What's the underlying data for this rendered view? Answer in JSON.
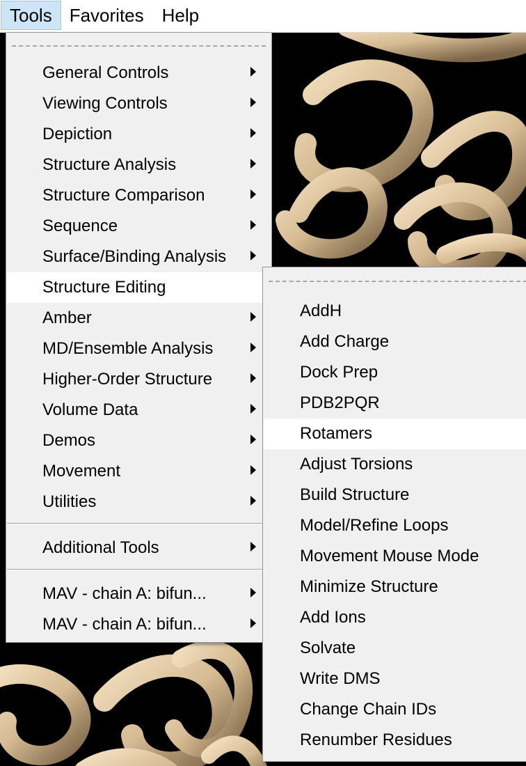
{
  "menubar": {
    "items": [
      {
        "label": "Tools",
        "active": true
      },
      {
        "label": "Favorites",
        "active": false
      },
      {
        "label": "Help",
        "active": false
      }
    ]
  },
  "tools_menu": {
    "items": [
      {
        "label": "General Controls",
        "submenu": true
      },
      {
        "label": "Viewing Controls",
        "submenu": true
      },
      {
        "label": "Depiction",
        "submenu": true
      },
      {
        "label": "Structure Analysis",
        "submenu": true
      },
      {
        "label": "Structure Comparison",
        "submenu": true
      },
      {
        "label": "Sequence",
        "submenu": true
      },
      {
        "label": "Surface/Binding Analysis",
        "submenu": true
      },
      {
        "label": "Structure Editing",
        "submenu": true,
        "highlighted": true
      },
      {
        "label": "Amber",
        "submenu": true
      },
      {
        "label": "MD/Ensemble Analysis",
        "submenu": true
      },
      {
        "label": "Higher-Order Structure",
        "submenu": true
      },
      {
        "label": "Volume Data",
        "submenu": true
      },
      {
        "label": "Demos",
        "submenu": true
      },
      {
        "label": "Movement",
        "submenu": true
      },
      {
        "label": "Utilities",
        "submenu": true
      }
    ],
    "additional": {
      "label": "Additional Tools",
      "submenu": true
    },
    "mav_items": [
      {
        "label": "MAV - chain A: bifun...",
        "submenu": true
      },
      {
        "label": "MAV - chain A: bifun...",
        "submenu": true
      }
    ]
  },
  "structure_editing_menu": {
    "items": [
      {
        "label": "AddH"
      },
      {
        "label": "Add Charge"
      },
      {
        "label": "Dock Prep"
      },
      {
        "label": "PDB2PQR"
      },
      {
        "label": "Rotamers",
        "highlighted": true
      },
      {
        "label": "Adjust Torsions"
      },
      {
        "label": "Build Structure"
      },
      {
        "label": "Model/Refine Loops"
      },
      {
        "label": "Movement Mouse Mode"
      },
      {
        "label": "Minimize Structure"
      },
      {
        "label": "Add Ions"
      },
      {
        "label": "Solvate"
      },
      {
        "label": "Write DMS"
      },
      {
        "label": "Change Chain IDs"
      },
      {
        "label": "Renumber Residues"
      }
    ]
  },
  "colors": {
    "ribbon": "#d9bf98",
    "ribbon_shadow": "#8a7455",
    "menu_bg": "#f0f0f0",
    "highlight": "#ffffff",
    "menubar_active": "#cde6f7"
  }
}
